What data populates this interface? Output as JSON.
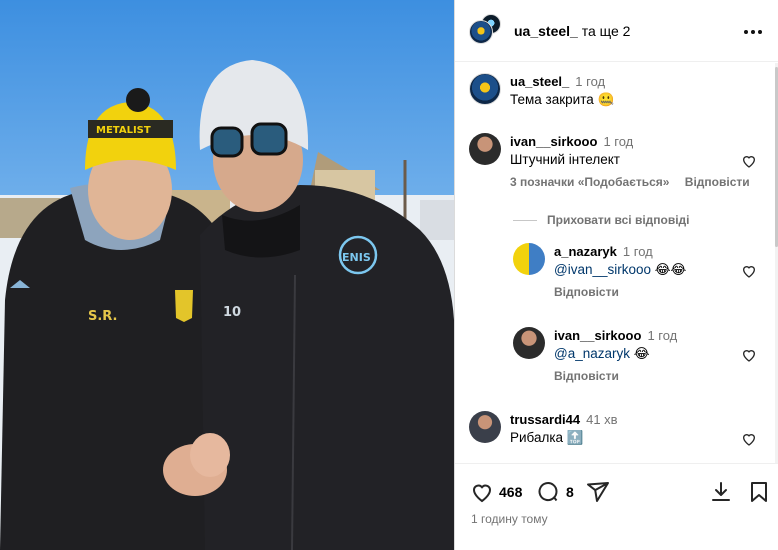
{
  "header": {
    "account": "ua_steel_",
    "suffix": "та ще 2"
  },
  "comments": [
    {
      "user": "ua_steel_",
      "time": "1 год",
      "text": "Тема закрита 🤐"
    },
    {
      "user": "ivan__sirkooo",
      "time": "1 год",
      "text": "Штучний інтелект",
      "likes": "3 позначки «Подобається»",
      "reply": "Відповісти"
    },
    {
      "user": "trussardi44",
      "time": "41 хв",
      "text": "Рибалка 🔝"
    }
  ],
  "hide_replies": "Приховати всі відповіді",
  "replies": [
    {
      "user": "a_nazaryk",
      "time": "1 год",
      "mention": "@ivan__sirkooo",
      "emoji": "😂😂",
      "reply": "Відповісти"
    },
    {
      "user": "ivan__sirkooo",
      "time": "1 год",
      "mention": "@a_nazaryk",
      "emoji": "😂",
      "reply": "Відповісти"
    }
  ],
  "actions": {
    "likes": "468",
    "comments": "8",
    "posted": "1 годину тому"
  },
  "photo": {
    "text_hat": "METALIST",
    "initials": "S.R.",
    "number": "10",
    "crest": "ENIS"
  },
  "colors": {
    "sky": "#5aa3e6",
    "jacket": "#1c1c1e",
    "hat_yellow": "#f2d20d",
    "link": "#00376b",
    "muted": "#737373"
  },
  "icons": [
    "heart-icon",
    "comment-icon",
    "share-icon",
    "download-icon",
    "bookmark-icon",
    "more-icon"
  ]
}
